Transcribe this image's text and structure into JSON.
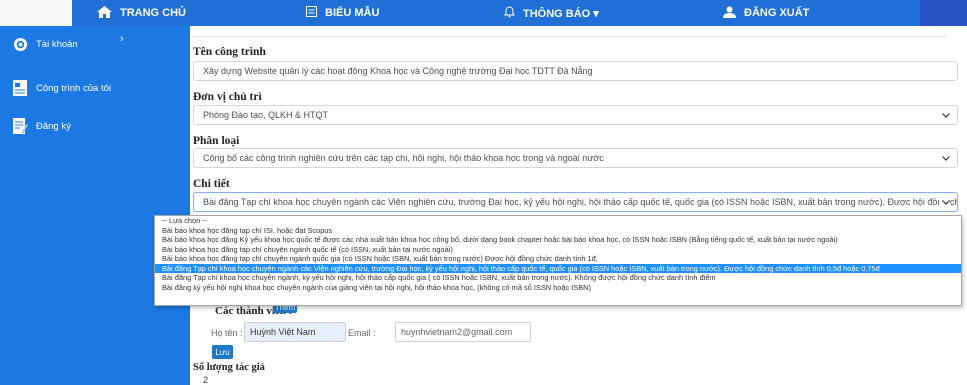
{
  "topnav": {
    "home": "TRANG CHỦ",
    "forms": "BIỂU MẪU",
    "notifications": "THÔNG BÁO ▾",
    "logout": "ĐĂNG XUẤT"
  },
  "sidebar": {
    "items": [
      {
        "label": "Tài khoản",
        "icon": "gear-icon",
        "chevron": "›"
      },
      {
        "label": "Công trình của tôi",
        "icon": "document-icon"
      },
      {
        "label": "Đăng ký",
        "icon": "register-icon"
      }
    ]
  },
  "form": {
    "ten_cong_trinh": {
      "label": "Tên công trình",
      "value": "Xây dựng Website quản lý các hoạt động Khoa học và Công nghệ trường Đại học  TDTT Đà Nẵng"
    },
    "don_vi_chu_tri": {
      "label": "Đơn vị chủ trì",
      "value": "Phòng Đào tạo, QLKH & HTQT"
    },
    "phan_loai": {
      "label": "Phân loại",
      "value": "Công bố các công trình nghiên cứu trên các tạp chí, hội nghị, hội thảo khoa học trong và ngoài nước"
    },
    "chi_tiet": {
      "label": "Chi tiết",
      "value": "Bài đăng Tạp chí khoa học chuyên ngành các Viện nghiên cứu, trường Đại học, kỷ yếu hội nghị, hội thảo cấp quốc tế, quốc gia (có ISSN hoặc ISBN, xuất bản trong nước). Được hội đồng chức danh tí"
    },
    "dropdown_options": [
      "-- Lựa chọn --",
      "Bài báo khoa học đăng tạp chí ISI, hoặc đạt Scopus",
      "Bài báo khoa học đăng Kỷ yếu khoa học quốc tế được các nhà xuất bản khoa học công bố, dưới dạng book chapter hoặc bài báo khoa học, có ISSN hoặc ISBN (Bằng tiếng quốc tế, xuất bản tại nước ngoài)",
      "Bài báo khoa học đăng tạp chí chuyên ngành quốc tế (có ISSN, xuất bản tại nước ngoài)",
      "Bài báo khoa học đăng tạp chí chuyên ngành quốc gia (có ISSN hoặc ISBN, xuất bản trong nước) Được hội đồng chức danh tính 1đ,",
      "Bài đăng Tạp chí khoa học chuyên ngành các Viện nghiên cứu, trường Đại học, kỷ yếu hội nghị, hội thảo cấp quốc tế, quốc gia (có ISSN hoặc ISBN, xuất bản trong nước). Được hội đồng chức danh tính 0,5đ hoặc 0,75đ",
      "Bài đăng Tạp chí khoa học chuyên ngành, kỷ yếu hội nghị, hội thảo cấp quốc gia ( có ISSN hoặc ISBN, xuất bản trong nước). Không được hội đồng chức danh tính điểm",
      "Bài đăng kỷ yếu hội nghị khoa học chuyên ngành của giảng viên tại hội nghị, hội thảo khoa học, (không có mã số ISSN hoặc ISBN)"
    ],
    "selected_index": 5,
    "thanh_vien_label": "Các thành viên :",
    "thanh_vien_button": "Thêm",
    "ho_ten_label": "Họ tên :",
    "ho_ten_value": "Huỳnh Việt Nam",
    "email_label": "Email :",
    "email_value": "huynhvietnam2@gmail.com",
    "luu_button": "Lưu",
    "so_luong_label": "Số lượng tác giả",
    "so_luong_value": "2"
  },
  "colors": {
    "nav": "#1f6fd6",
    "sidebar": "#1c78e3",
    "selected": "#1e90ff"
  }
}
